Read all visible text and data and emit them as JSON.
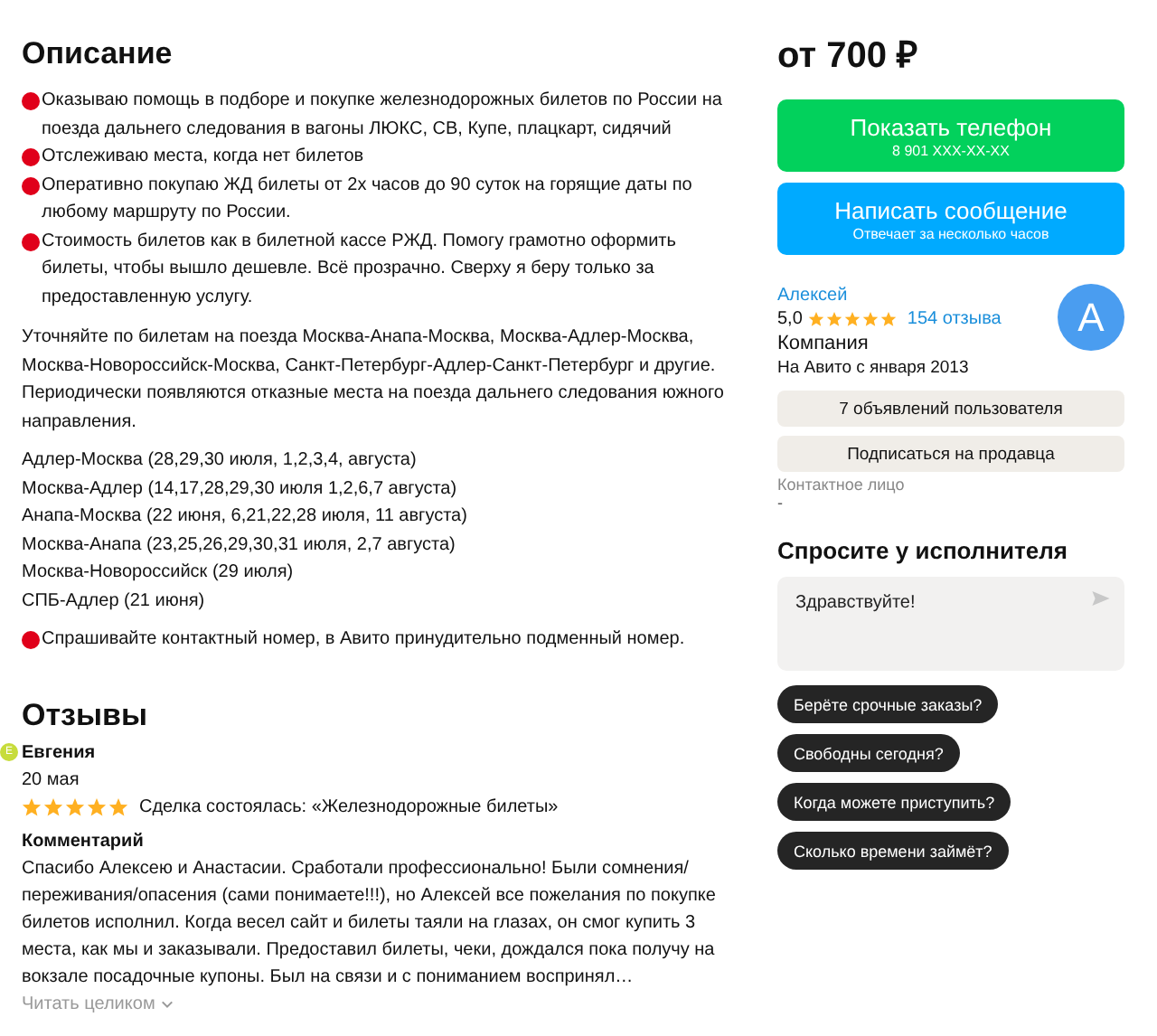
{
  "description": {
    "title": "Описание",
    "blocks": [
      {
        "kind": "bullet",
        "text": "Оказываю помощь в подборе и покупке железнодорожных билетов по России на поезда дальнего следования в вагоны ЛЮКС, СВ, Купе, плацкарт, сидячий"
      },
      {
        "kind": "bullet",
        "text": "Отслеживаю места, когда нет билетов"
      },
      {
        "kind": "bullet",
        "text": "Оперативно покупаю ЖД билеты от 2х часов до 90 суток на горящие даты по любому маршруту по России."
      },
      {
        "kind": "bullet",
        "text": "Стоимость билетов как в билетной кассе РЖД. Помогу грамотно оформить билеты, чтобы вышло дешевле. Всё прозрачно. Сверху я беру только за предоставленную услугу."
      },
      {
        "kind": "paragraph",
        "text": "Уточняйте по билетам на поезда Москва-Анапа-Москва, Москва-Адлер-Москва, Москва-Новороссийск-Москва, Санкт-Петербург-Адлер-Санкт-Петербург и другие. Периодически появляются отказные места на поезда дальнего следования южного направления."
      },
      {
        "kind": "lines",
        "lines": [
          "Адлер-Москва (28,29,30 июля, 1,2,3,4, августа)",
          "Москва-Адлер (14,17,28,29,30 июля 1,2,6,7 августа)",
          "Анапа-Москва (22 июня, 6,21,22,28 июля, 11 августа)",
          "Москва-Анапа (23,25,26,29,30,31 июля, 2,7 августа)",
          "Москва-Новороссийск (29 июля)",
          "СПБ-Адлер (21 июня)"
        ]
      },
      {
        "kind": "bullet",
        "text": "Спрашивайте контактный номер, в Авито принудительно подменный номер."
      }
    ]
  },
  "reviews": {
    "title": "Отзывы",
    "items": [
      {
        "avatar_letter": "Е",
        "author": "Евгения",
        "date": "20 мая",
        "stars": 5,
        "deal": "Сделка состоялась: «Железнодорожные билеты»",
        "comment_label": "Комментарий",
        "comment": "Спасибо Алексею и Анастасии. Сработали профессионально! Были сомнения/переживания/опасения (сами понимаете!!!), но Алексей все пожелания по покупке билетов исполнил. Когда весел сайт и билеты таяли на глазах, он смог купить 3 места, как мы и заказывали. Предоставил билеты, чеки, дождался пока получу на вокзале посадочные купоны. Был на связи и с пониманием воспринял…",
        "read_more": "Читать целиком"
      }
    ]
  },
  "sidebar": {
    "price": "от 700 ₽",
    "buttons": [
      {
        "kind": "phone",
        "label": "Показать телефон",
        "sublabel": "8 901 XXX-XX-XX"
      },
      {
        "kind": "message",
        "label": "Написать сообщение",
        "sublabel": "Отвечает за несколько часов"
      }
    ],
    "seller": {
      "name": "Алексей",
      "rating": "5,0",
      "stars": 5,
      "reviews_link": "154 отзыва",
      "type": "Компания",
      "since": "На Авито с января 2013",
      "avatar_letter": "А"
    },
    "seller_buttons": [
      "7 объявлений пользователя",
      "Подписаться на продавца"
    ],
    "contact_label": "Контактное лицо",
    "contact_value": "-",
    "ask": {
      "title": "Спросите у исполнителя",
      "message": "Здравствуйте!",
      "suggestions": [
        "Берёте срочные заказы?",
        "Свободны сегодня?",
        "Когда можете приступить?",
        "Сколько времени займёт?"
      ]
    }
  }
}
